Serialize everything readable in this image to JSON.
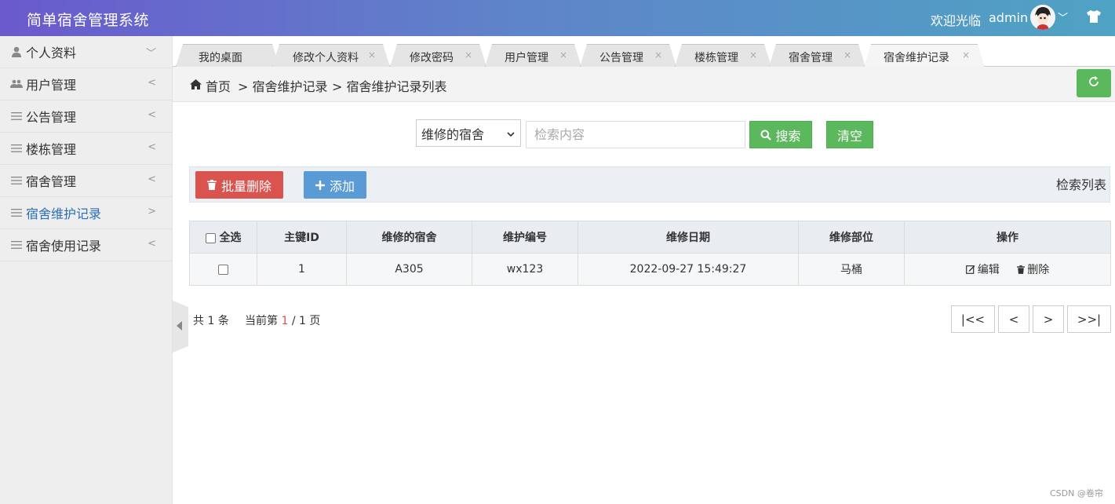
{
  "header": {
    "app_title": "简单宿舍管理系统",
    "welcome": "欢迎光临",
    "username": "admin",
    "caret": "﹀"
  },
  "sidebar": {
    "items": [
      {
        "label": "个人资料",
        "arrow": "﹀"
      },
      {
        "label": "用户管理",
        "arrow": "<"
      },
      {
        "label": "公告管理",
        "arrow": "<"
      },
      {
        "label": "楼栋管理",
        "arrow": "<"
      },
      {
        "label": "宿舍管理",
        "arrow": "<"
      },
      {
        "label": "宿舍维护记录",
        "arrow": ">"
      },
      {
        "label": "宿舍使用记录",
        "arrow": "<"
      }
    ]
  },
  "tabs": [
    {
      "label": "我的桌面"
    },
    {
      "label": "修改个人资料",
      "close": "×"
    },
    {
      "label": "修改密码",
      "close": "×"
    },
    {
      "label": "用户管理",
      "close": "×"
    },
    {
      "label": "公告管理",
      "close": "×"
    },
    {
      "label": "楼栋管理",
      "close": "×"
    },
    {
      "label": "宿舍管理",
      "close": "×"
    },
    {
      "label": "宿舍维护记录",
      "close": "×"
    }
  ],
  "breadcrumb": {
    "home": "首页",
    "level1": "> 宿舍维护记录",
    "level2": "> 宿舍维护记录列表"
  },
  "search": {
    "field_selected": "维修的宿舍",
    "placeholder": "检索内容",
    "search_label": "搜索",
    "clear_label": "清空"
  },
  "toolbar": {
    "batch_delete_label": "批量删除",
    "add_label": "添加",
    "title": "检索列表"
  },
  "table": {
    "select_all_label": "全选",
    "headers": [
      "主键ID",
      "维修的宿舍",
      "维护编号",
      "维修日期",
      "维修部位",
      "操作"
    ],
    "rows": [
      {
        "id": "1",
        "dorm": "A305",
        "code": "wx123",
        "date": "2022-09-27 15:49:27",
        "part": "马桶",
        "edit": "编辑",
        "delete": "删除"
      }
    ]
  },
  "pager": {
    "total_prefix": "共",
    "total": "1",
    "total_suffix": "条",
    "current_prefix": "当前第",
    "current": "1",
    "separator": "/",
    "pages": "1",
    "pages_suffix": "页",
    "first": "|<<",
    "prev": "<",
    "next": ">",
    "last": ">>|"
  },
  "watermark": "CSDN @卷帘",
  "colors": {
    "success": "#5cb85c",
    "danger": "#d9534f",
    "primary": "#5b9bd5",
    "active_menu": "#2a6fb5"
  }
}
